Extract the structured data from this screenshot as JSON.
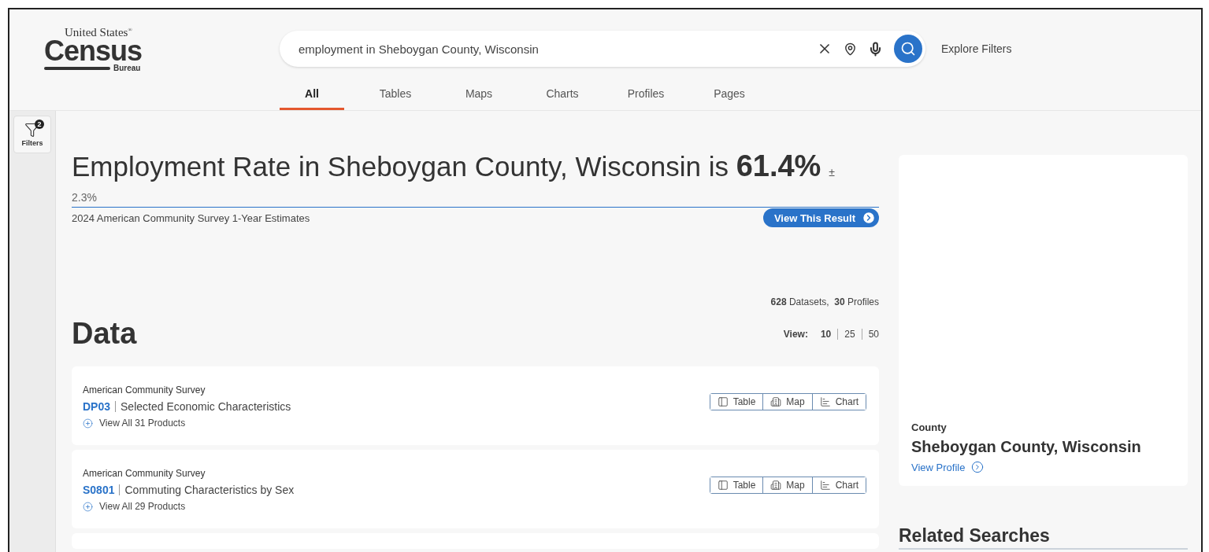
{
  "logo": {
    "top": "United States",
    "mark": "®",
    "main": "Census",
    "sub": "Bureau"
  },
  "search": {
    "value": "employment in Sheboygan County, Wisconsin"
  },
  "explore_filters": "Explore Filters",
  "tabs": [
    {
      "label": "All",
      "selected": true
    },
    {
      "label": "Tables",
      "selected": false
    },
    {
      "label": "Maps",
      "selected": false
    },
    {
      "label": "Charts",
      "selected": false
    },
    {
      "label": "Profiles",
      "selected": false
    },
    {
      "label": "Pages",
      "selected": false
    }
  ],
  "filters": {
    "label": "Filters",
    "count": "2"
  },
  "answer": {
    "text": "Employment Rate in Sheboygan County, Wisconsin is",
    "value": "61.4%",
    "moe_sign": "±",
    "moe": "2.3%",
    "source": "2024 American Community Survey 1-Year Estimates",
    "button": "View This Result"
  },
  "counts": "**628** Datasets,  **30** Profiles",
  "data_heading": "Data",
  "view": {
    "label": "View:",
    "options": [
      {
        "label": "10",
        "selected": true
      },
      {
        "label": "25",
        "selected": false
      },
      {
        "label": "50",
        "selected": false
      }
    ]
  },
  "results": [
    {
      "source": "American Community Survey",
      "code": "DP03",
      "title": "Selected Economic Characteristics",
      "more": "View All 31 Products",
      "actions": [
        "Table",
        "Map",
        "Chart"
      ]
    },
    {
      "source": "American Community Survey",
      "code": "S0801",
      "title": "Commuting Characteristics by Sex",
      "more": "View All 29 Products",
      "actions": [
        "Table",
        "Map",
        "Chart"
      ]
    }
  ],
  "profile": {
    "type": "County",
    "name": "Sheboygan County, Wisconsin",
    "link": "View Profile"
  },
  "related_heading": "Related Searches"
}
